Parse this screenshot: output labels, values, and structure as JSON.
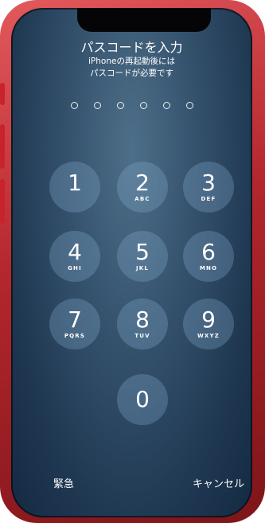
{
  "header": {
    "title": "パスコードを入力",
    "subtitle_line1": "iPhoneの再起動後には",
    "subtitle_line2": "パスコードが必要です"
  },
  "passcode": {
    "length": 6,
    "entered": 0
  },
  "keypad": {
    "keys": [
      {
        "digit": "1",
        "letters": ""
      },
      {
        "digit": "2",
        "letters": "ABC"
      },
      {
        "digit": "3",
        "letters": "DEF"
      },
      {
        "digit": "4",
        "letters": "GHI"
      },
      {
        "digit": "5",
        "letters": "JKL"
      },
      {
        "digit": "6",
        "letters": "MNO"
      },
      {
        "digit": "7",
        "letters": "PQRS"
      },
      {
        "digit": "8",
        "letters": "TUV"
      },
      {
        "digit": "9",
        "letters": "WXYZ"
      },
      {
        "digit": "0",
        "letters": ""
      }
    ]
  },
  "actions": {
    "emergency": "緊急",
    "cancel": "キャンセル"
  },
  "colors": {
    "frame": "#c8222b",
    "screen_top": "#4e6f89",
    "screen_bottom": "#142a43",
    "key_fill": "rgba(135,175,210,0.30)"
  }
}
